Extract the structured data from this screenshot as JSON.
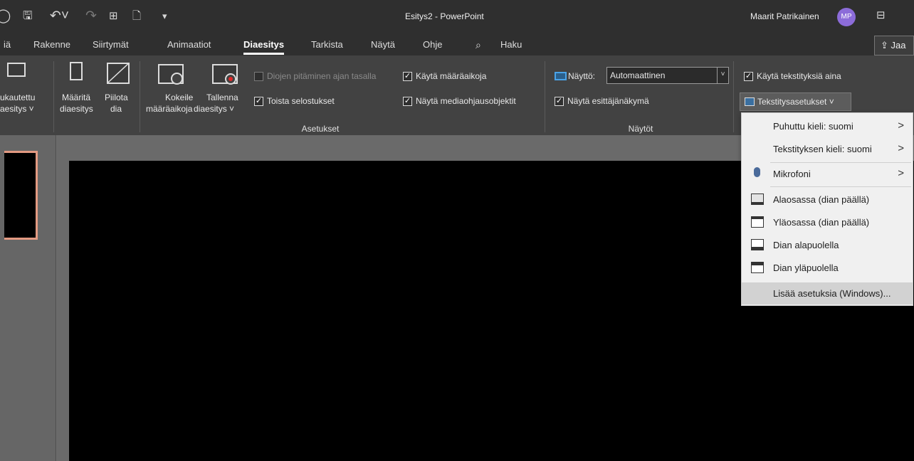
{
  "window": {
    "title": "Esitys2 - PowerPoint",
    "user_name": "Maarit Patrikainen",
    "user_initials": "MP"
  },
  "tabs": [
    "iä",
    "Rakenne",
    "Siirtymät",
    "Animaatiot",
    "Diaesitys",
    "Tarkista",
    "Näytä",
    "Ohje"
  ],
  "active_tab": "Diaesitys",
  "search": {
    "label": "Haku"
  },
  "share": {
    "label": "Jaa"
  },
  "ribbon": {
    "custom_show": {
      "line1": "ukautettu",
      "line2": "aesitys ˅"
    },
    "setup_show": {
      "line1": "Määritä",
      "line2": "diaesitys"
    },
    "hide_slide": {
      "line1": "Piilota",
      "line2": "dia"
    },
    "rehearse": {
      "line1": "Kokeile",
      "line2": "määräaikoja"
    },
    "record": {
      "line1": "Tallenna",
      "line2": "diaesitys ˅"
    },
    "keep_fresh": "Diojen pitäminen ajan tasalla",
    "play_narrations": "Toista selostukset",
    "use_timings": "Käytä määräaikoja",
    "show_media_controls": "Näytä mediaohjausobjektit",
    "monitor_label": "Näyttö:",
    "monitor_value": "Automaattinen",
    "presenter_view": "Näytä esittäjänäkymä",
    "always_subtitles": "Käytä tekstityksiä aina",
    "subtitle_settings": "Tekstitysasetukset ˅",
    "group_setup": "Asetukset",
    "group_monitors": "Näytöt"
  },
  "menu": {
    "spoken_language": "Puhuttu kieli: suomi",
    "subtitle_language": "Tekstityksen kieli: suomi",
    "microphone": "Mikrofoni",
    "bottom_overlaid": "Alaosassa (dian päällä)",
    "top_overlaid": "Yläosassa (dian päällä)",
    "below_slide": "Dian alapuolella",
    "above_slide": "Dian yläpuolella",
    "more_settings": "Lisää asetuksia (Windows)..."
  },
  "colors": {
    "accent_avatar": "#8c6cd9",
    "thumbnail_border": "#e39a82"
  }
}
